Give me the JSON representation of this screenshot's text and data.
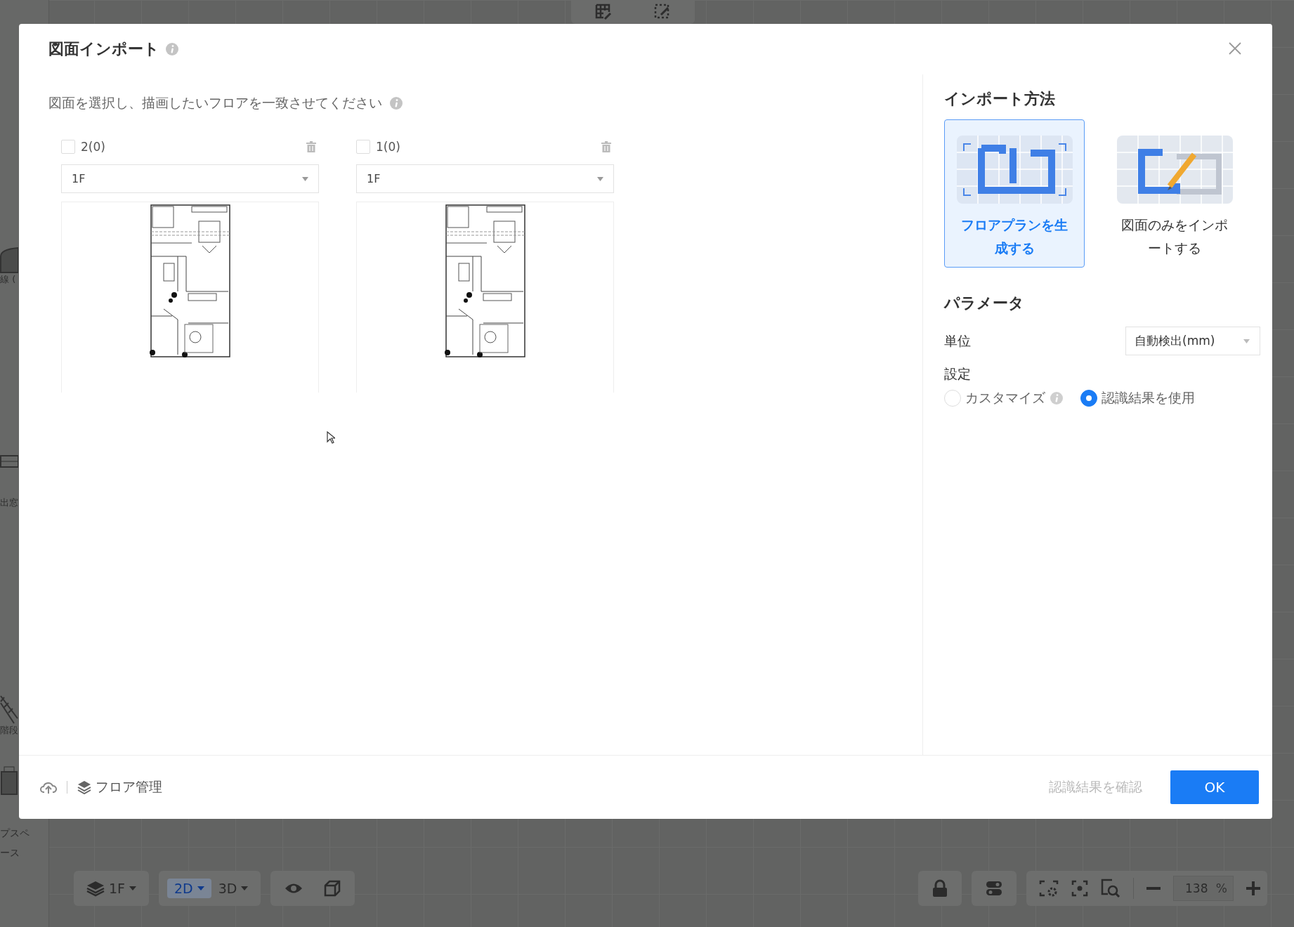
{
  "background_app": {
    "sidebar_labels": [
      "線 (",
      "出窓",
      "階段",
      "プスペ",
      "ース"
    ],
    "floor_selector": "1F",
    "view_modes": [
      {
        "label": "2D",
        "selected": true
      },
      {
        "label": "3D",
        "selected": false
      }
    ],
    "zoom_value": "138",
    "zoom_unit": "%"
  },
  "dialog": {
    "title": "図面インポート",
    "instruction": "図面を選択し、描画したいフロアを一致させてください",
    "drawings": [
      {
        "name": "2(0)",
        "checked": false,
        "floor": "1F"
      },
      {
        "name": "1(0)",
        "checked": false,
        "floor": "1F"
      }
    ],
    "import_method": {
      "title": "インポート方法",
      "options": [
        {
          "label": "フロアプランを生成する",
          "selected": true
        },
        {
          "label": "図面のみをインポートする",
          "selected": false
        }
      ]
    },
    "parameters": {
      "title": "パラメータ",
      "unit_label": "単位",
      "unit_value": "自動検出(mm)",
      "setting_label": "設定",
      "setting_options": [
        {
          "label": "カスタマイズ",
          "selected": false,
          "info": true
        },
        {
          "label": "認識結果を使用",
          "selected": true,
          "info": false
        }
      ]
    },
    "footer": {
      "floor_manage": "フロア管理",
      "confirm": {
        "label": "認識結果を確認",
        "disabled": true
      },
      "ok": "OK"
    }
  }
}
